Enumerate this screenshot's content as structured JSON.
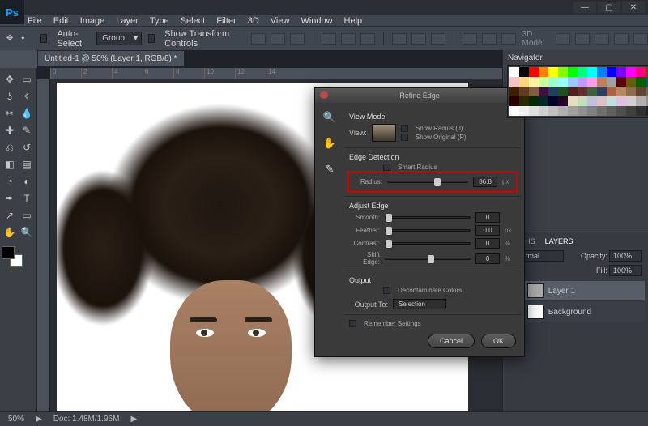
{
  "window": {
    "min": "—",
    "max": "▢",
    "close": "✕"
  },
  "menu": {
    "file": "File",
    "edit": "Edit",
    "image": "Image",
    "layer": "Layer",
    "type": "Type",
    "select": "Select",
    "filter": "Filter",
    "threeD": "3D",
    "view": "View",
    "window": "Window",
    "help": "Help"
  },
  "options": {
    "auto_select": "Auto-Select:",
    "group": "Group",
    "show_transform": "Show Transform Controls",
    "mode_label": "3D Mode:"
  },
  "document": {
    "tab_title": "Untitled-1 @ 50% (Layer 1, RGB/8) *",
    "ruler": [
      "0",
      "2",
      "4",
      "6",
      "8",
      "10",
      "12",
      "14"
    ]
  },
  "panels": {
    "navigator": "Navigator",
    "swatch_colors": [
      "#ffffff",
      "#000000",
      "#ff0000",
      "#ff7f00",
      "#ffff00",
      "#7fff00",
      "#00ff00",
      "#00ff7f",
      "#00ffff",
      "#007fff",
      "#0000ff",
      "#7f00ff",
      "#ff00ff",
      "#ff007f",
      "#804000",
      "#808080",
      "#f4c2c2",
      "#ffd27f",
      "#fff4a3",
      "#c9ff9a",
      "#9affc9",
      "#9affff",
      "#9ac9ff",
      "#c29aff",
      "#ff9ae6",
      "#bf8060",
      "#a0a0a0",
      "#600000",
      "#606000",
      "#006000",
      "#006060",
      "#000060",
      "#3f1f00",
      "#5f3f1f",
      "#7f5f3f",
      "#401040",
      "#204060",
      "#205020",
      "#502020",
      "#603030",
      "#406040",
      "#304060",
      "#ad6242",
      "#b58863",
      "#8c6d4f",
      "#5e4632",
      "#6e6655",
      "#4d4d4d",
      "#2a0000",
      "#2a2a00",
      "#002a00",
      "#002a2a",
      "#00002a",
      "#2a002a",
      "#e0e0c0",
      "#c0e0c0",
      "#c0c0e0",
      "#e0c0c0",
      "#c0e0e0",
      "#e0c0e0",
      "#d0d0d0",
      "#b0b0b0",
      "#909090",
      "#707070",
      "#fefefe",
      "#f0f0f0",
      "#e0e0e0",
      "#d0d0d0",
      "#c0c0c0",
      "#b0b0b0",
      "#a0a0a0",
      "#909090",
      "#808080",
      "#707070",
      "#606060",
      "#505050",
      "#404040",
      "#303030",
      "#202020",
      "#101010"
    ],
    "layers": {
      "tabs": {
        "paths": "PATHS",
        "layers": "LAYERS"
      },
      "opacity_label": "Opacity:",
      "fill_label": "Fill:",
      "opacity_value": "100%",
      "fill_value": "100%",
      "layer1": "Layer 1",
      "bg": "Background"
    }
  },
  "dialog": {
    "title": "Refine Edge",
    "view_mode": "View Mode",
    "view_label": "View:",
    "show_radius": "Show Radius (J)",
    "show_original": "Show Original (P)",
    "edge_detection": "Edge Detection",
    "smart_radius": "Smart Radius",
    "radius_label": "Radius:",
    "radius_value": "86.8",
    "radius_unit": "px",
    "adjust_edge": "Adjust Edge",
    "smooth": "Smooth:",
    "smooth_value": "0",
    "feather": "Feather:",
    "feather_value": "0.0",
    "feather_unit": "px",
    "contrast": "Contrast:",
    "contrast_value": "0",
    "contrast_unit": "%",
    "shift_edge": "Shift Edge:",
    "shift_value": "0",
    "shift_unit": "%",
    "output": "Output",
    "decontaminate": "Decontaminate Colors",
    "output_to": "Output To:",
    "output_sel": "Selection",
    "remember": "Remember Settings",
    "cancel": "Cancel",
    "ok": "OK"
  },
  "status": {
    "zoom": "50%",
    "doc": "Doc: 1.48M/1.96M"
  },
  "icons": {
    "move": "✥",
    "zoom": "🔍",
    "hand": "✋",
    "brush": "✎",
    "arrow_play": "▶"
  }
}
